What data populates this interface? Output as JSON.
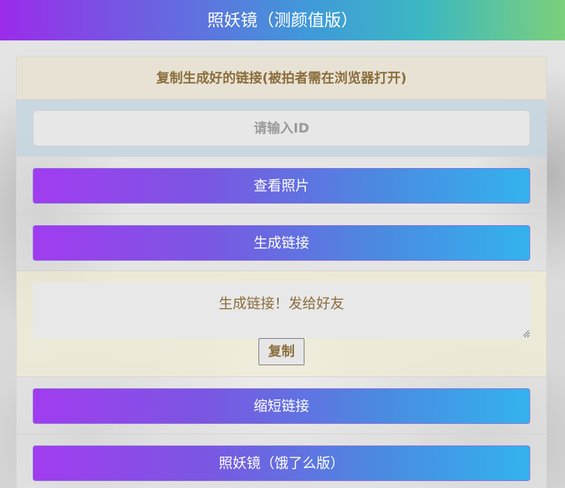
{
  "header": {
    "title": "照妖镜（测颜值版）"
  },
  "panel": {
    "heading": "复制生成好的链接(被拍者需在浏览器打开)",
    "id_input": {
      "placeholder": "请输入ID",
      "value": ""
    },
    "buttons": {
      "view_photos": "查看照片",
      "generate_link": "生成链接",
      "shorten_link": "缩短链接",
      "eleme_version": "照妖镜（饿了么版）"
    },
    "link_output": {
      "value": "生成链接！发给好友"
    },
    "copy_button": "复制"
  },
  "colors": {
    "header_gradient": [
      "#9b2bea",
      "#3f9ad9",
      "#7cd07a"
    ],
    "button_gradient": [
      "#a13cf0",
      "#33b3ee"
    ],
    "heading_text": "#8a6d3b"
  }
}
